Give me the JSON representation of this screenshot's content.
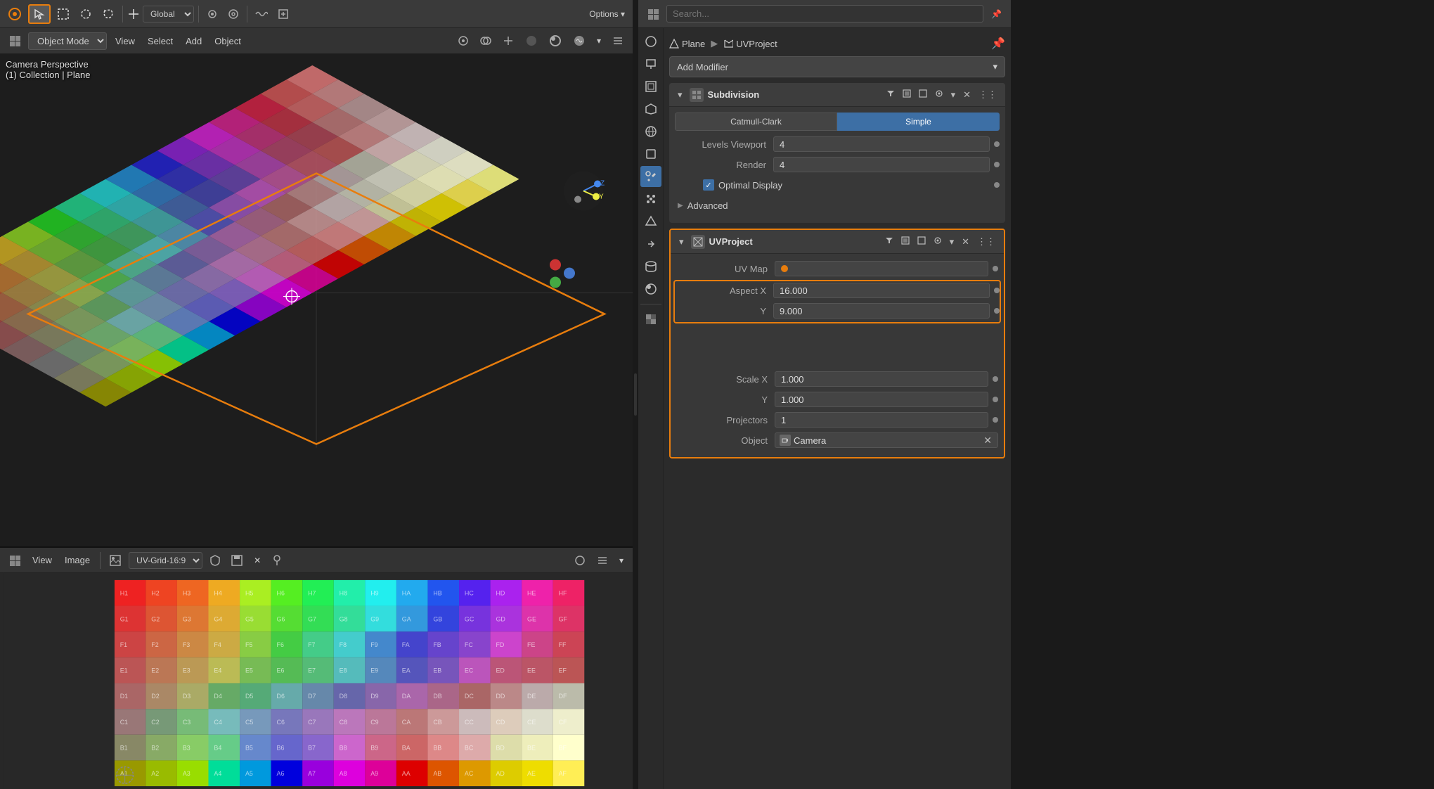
{
  "app": {
    "title": "Blender"
  },
  "top_toolbar": {
    "mode_label": "Global",
    "options_label": "Options ▾"
  },
  "viewport": {
    "mode_dropdown": "Object Mode",
    "menu_items": [
      "View",
      "Select",
      "Add",
      "Object"
    ],
    "select_label": "Select",
    "overlay_line1": "Camera Perspective",
    "overlay_line2": "(1) Collection | Plane"
  },
  "uv_editor": {
    "toolbar_items": [
      "View",
      "Image"
    ],
    "image_label": "UV-Grid-16:9"
  },
  "properties": {
    "breadcrumb": {
      "plane": "Plane",
      "arrow": "▶",
      "uvproject": "UVProject"
    },
    "add_modifier_label": "Add Modifier",
    "subdivision": {
      "name": "Subdivision",
      "mode_catmull": "Catmull-Clark",
      "mode_simple": "Simple",
      "levels_viewport_label": "Levels Viewport",
      "levels_viewport_value": "4",
      "render_label": "Render",
      "render_value": "4",
      "optimal_display_label": "Optimal Display",
      "advanced_label": "Advanced"
    },
    "uvproject": {
      "name": "UVProject",
      "uv_map_label": "UV Map",
      "aspect_x_label": "Aspect X",
      "aspect_x_value": "16.000",
      "aspect_y_label": "Y",
      "aspect_y_value": "9.000",
      "scale_x_label": "Scale X",
      "scale_x_value": "1.000",
      "scale_y_label": "Y",
      "scale_y_value": "1.000",
      "projectors_label": "Projectors",
      "projectors_value": "1",
      "object_label": "Object",
      "object_value": "Camera"
    }
  },
  "icons": {
    "search": "🔍",
    "pin": "📌",
    "wrench": "🔧",
    "camera": "📷",
    "mesh": "◈",
    "material": "●",
    "world": "🌍",
    "scene": "🎬",
    "render": "🎥",
    "object": "▲",
    "filter": "▼",
    "eye": "👁",
    "shield": "🛡",
    "camera_sm": "📷",
    "close": "✕",
    "check": "✓",
    "arrow_right": "▶",
    "arrow_down": "▾",
    "chevron": "⊞"
  },
  "uv_grid_rows": [
    "H",
    "G",
    "F",
    "E",
    "D",
    "C",
    "B",
    "A"
  ],
  "uv_grid_cols": [
    "1",
    "2",
    "3",
    "4",
    "5",
    "6",
    "7",
    "8",
    "9",
    "A",
    "B",
    "C",
    "D",
    "E",
    "F"
  ],
  "colors": {
    "accent_orange": "#e87d0d",
    "accent_blue": "#3d6fa5",
    "border_highlight": "#e87d0d",
    "bg_dark": "#1d1d1d",
    "bg_mid": "#2b2b2b",
    "bg_light": "#3a3a3a"
  }
}
